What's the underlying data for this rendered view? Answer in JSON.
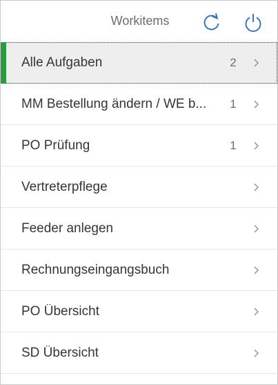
{
  "header": {
    "title": "Workitems",
    "refresh_icon": "refresh-icon",
    "logout_icon": "power-icon"
  },
  "accent_color": "#2b9b3f",
  "items": [
    {
      "label": "Alle Aufgaben",
      "count": "2"
    },
    {
      "label": "MM Bestellung ändern / WE b...",
      "count": "1"
    },
    {
      "label": "PO Prüfung",
      "count": "1"
    },
    {
      "label": "Vertreterpflege",
      "count": ""
    },
    {
      "label": "Feeder anlegen",
      "count": ""
    },
    {
      "label": "Rechnungseingangsbuch",
      "count": ""
    },
    {
      "label": "PO Übersicht",
      "count": ""
    },
    {
      "label": "SD Übersicht",
      "count": ""
    }
  ]
}
